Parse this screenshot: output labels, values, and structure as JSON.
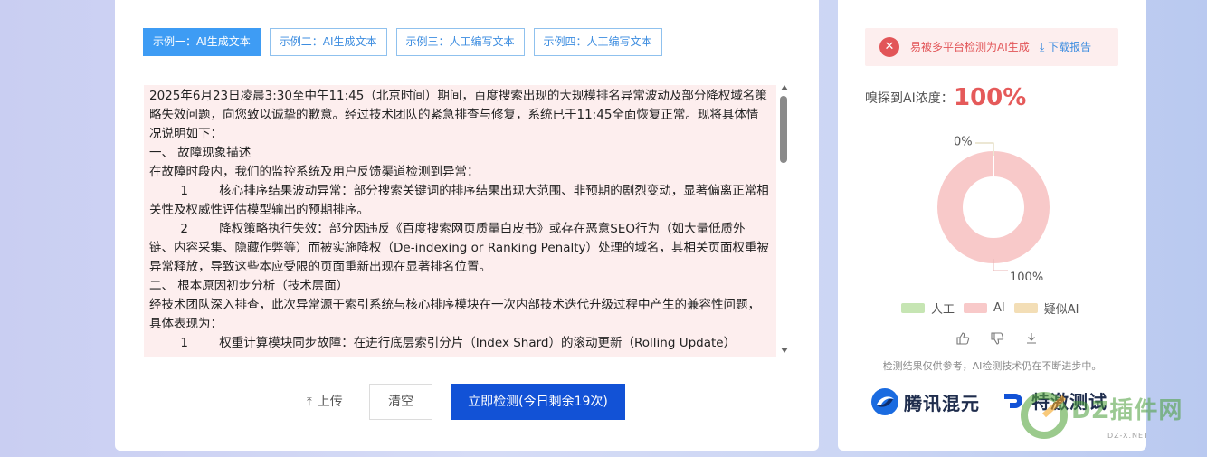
{
  "tabs": [
    {
      "label": "示例一：AI生成文本",
      "active": true
    },
    {
      "label": "示例二：AI生成文本",
      "active": false
    },
    {
      "label": "示例三：人工编写文本",
      "active": false
    },
    {
      "label": "示例四：人工编写文本",
      "active": false
    }
  ],
  "input_text": {
    "lines": [
      "2025年6月23日凌晨3:30至中午11:45（北京时间）期间，百度搜索出现的大规模排名异常波动及部分降权域名策略失效问题，向您致以诚挚的歉意。经过技术团队的紧急排查与修复，系统已于11:45全面恢复正常。现将具体情况说明如下：",
      "一、 故障现象描述",
      "在故障时段内，我们的监控系统及用户反馈渠道检测到异常：",
      "        1        核心排序结果波动异常：部分搜索关键词的排序结果出现大范围、非预期的剧烈变动，显著偏离正常相关性及权威性评估模型输出的预期排序。",
      "        2        降权策略执行失效：部分因违反《百度搜索网页质量白皮书》或存在恶意SEO行为（如大量低质外链、内容采集、隐藏作弊等）而被实施降权（De-indexing or Ranking Penalty）处理的域名，其相关页面权重被异常释放，导致这些本应受限的页面重新出现在显著排名位置。",
      "二、 根本原因初步分析（技术层面）",
      "经技术团队深入排查，此次异常源于索引系统与核心排序模块在一次内部技术迭代升级过程中产生的兼容性问题，具体表现为：",
      "        1        权重计算模块同步故障：在进行底层索引分片（Index Shard）的滚动更新（Rolling Update）"
    ]
  },
  "actions": {
    "upload_label": "上传",
    "clear_label": "清空",
    "detect_label": "立即检测(今日剩余19次)"
  },
  "result": {
    "alert_text": "易被多平台检测为AI生成",
    "download_label": "下载报告",
    "concentration_label": "嗅探到AI浓度：",
    "concentration_value": "100%",
    "donut_label_top": "0%",
    "donut_label_bottom": "100%",
    "legend": [
      {
        "label": "人工",
        "color": "#c6e5b3"
      },
      {
        "label": "AI",
        "color": "#f8c9c9"
      },
      {
        "label": "疑似AI",
        "color": "#f3deb6"
      }
    ],
    "disclaimer": "检测结果仅供参考，AI检测技术仍在不断进步中。",
    "brand_1": "腾讯混元",
    "brand_2": "特激测试"
  },
  "chart_data": {
    "type": "pie",
    "categories": [
      "人工",
      "AI",
      "疑似AI"
    ],
    "values": [
      0,
      100,
      0
    ],
    "labels": [
      "0%",
      "100%"
    ]
  },
  "watermark": {
    "text": "DZ插件网",
    "sub": "DZ-X.NET"
  },
  "colors": {
    "primary": "#1252d6",
    "tab_active": "#3e9cf4",
    "alert": "#e25558",
    "ai_pink": "#f8c9c9"
  }
}
